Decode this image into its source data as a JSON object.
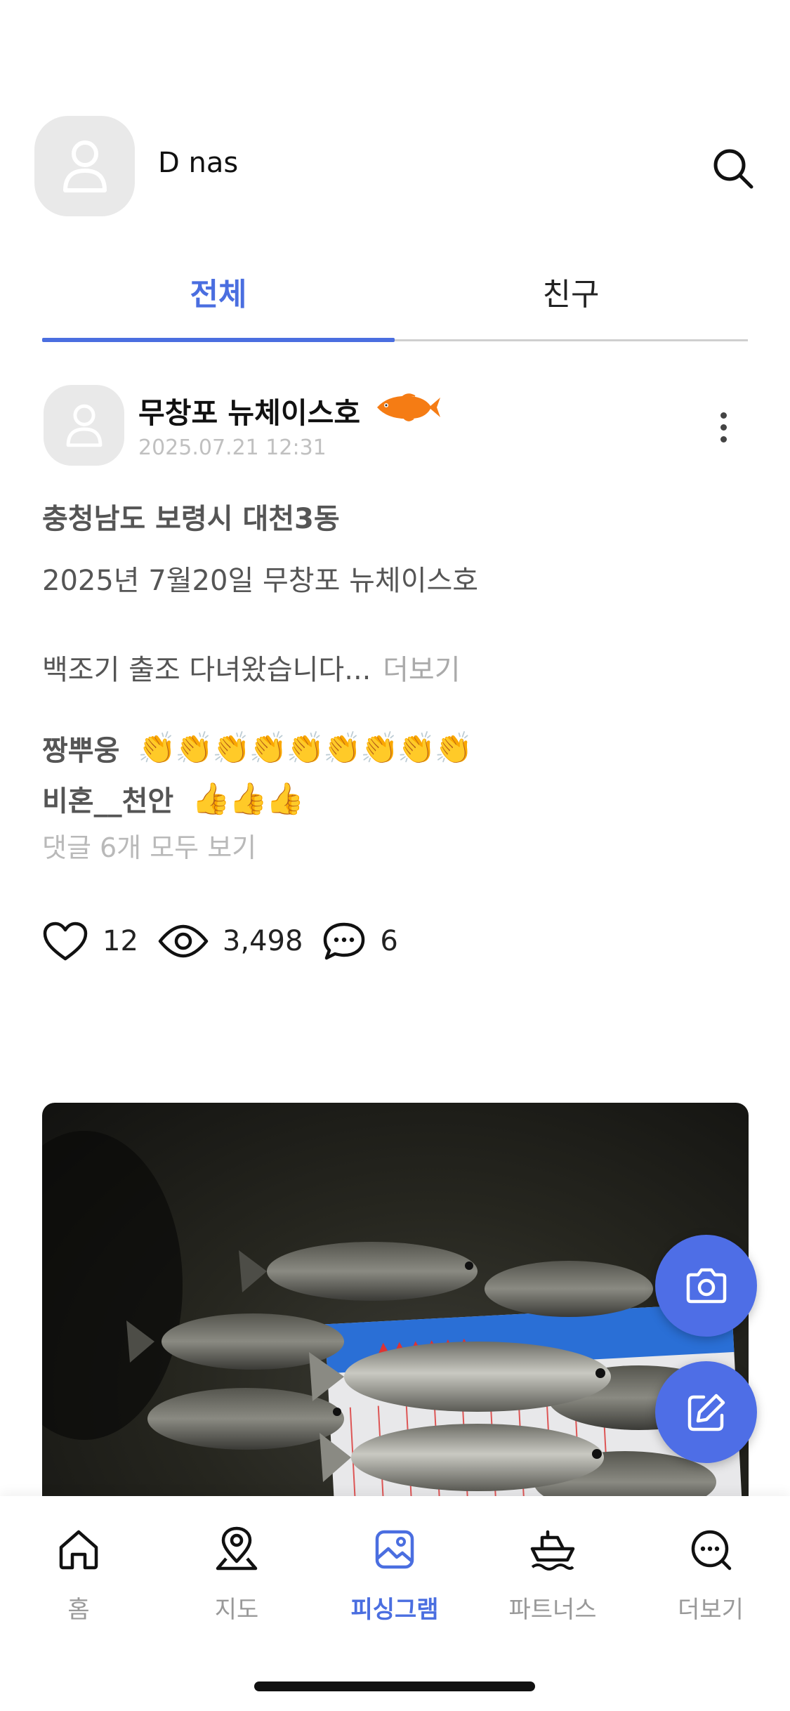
{
  "header": {
    "profile_name": "D nas"
  },
  "tabs": [
    {
      "label": "전체",
      "active": true
    },
    {
      "label": "친구",
      "active": false
    }
  ],
  "post": {
    "author": "무창포 뉴체이스호",
    "date": "2025.07.21 12:31",
    "location": "충청남도 보령시 대천3동",
    "content_line1": "2025년 7월20일 무창포 뉴체이스호",
    "content_line2": "백조기 출조  다녀왔습니다...",
    "more_label": "더보기",
    "comments": [
      {
        "author": "짱뿌웅",
        "text": "👏👏👏👏👏👏👏👏👏"
      },
      {
        "author": "비혼__천안",
        "text": "👍👍👍"
      }
    ],
    "view_all_comments": "댓글 6개 모두 보기",
    "likes": "12",
    "views": "3,498",
    "comment_count": "6"
  },
  "nav": [
    {
      "label": "홈",
      "icon": "home-icon",
      "active": false
    },
    {
      "label": "지도",
      "icon": "map-pin-icon",
      "active": false
    },
    {
      "label": "피싱그램",
      "icon": "gallery-icon",
      "active": true
    },
    {
      "label": "파트너스",
      "icon": "boat-icon",
      "active": false
    },
    {
      "label": "더보기",
      "icon": "more-chat-icon",
      "active": false
    }
  ],
  "colors": {
    "accent": "#4a6ee0",
    "fab": "#4e6ee6",
    "fish_badge": "#f57c14"
  }
}
